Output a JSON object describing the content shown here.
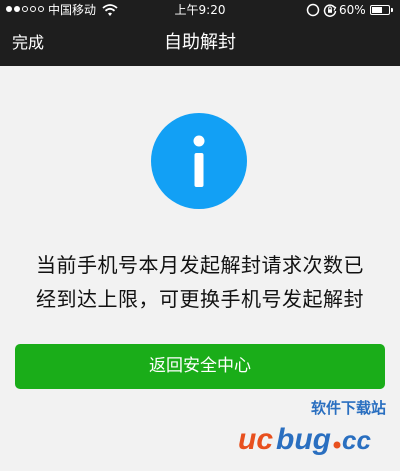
{
  "status_bar": {
    "signal_dots": {
      "filled": 2,
      "total": 5
    },
    "carrier": "中国移动",
    "wifi_icon": "wifi-icon",
    "time": "上午9:20",
    "lock_icon": "orientation-lock-icon",
    "battery_percent": "60%",
    "battery_level": 0.6
  },
  "nav": {
    "done_label": "完成",
    "title": "自助解封"
  },
  "main": {
    "icon": "info-icon",
    "icon_color": "#12a0f5",
    "message_lines": [
      "当前手机号本月发起解封请求次数已",
      "经到达上限，可更换手机号发起解封"
    ],
    "button_label": "返回安全中心",
    "button_color": "#1aad19"
  },
  "watermark": {
    "tagline": "软件下载站",
    "logo_text": "ucbug.cc"
  }
}
